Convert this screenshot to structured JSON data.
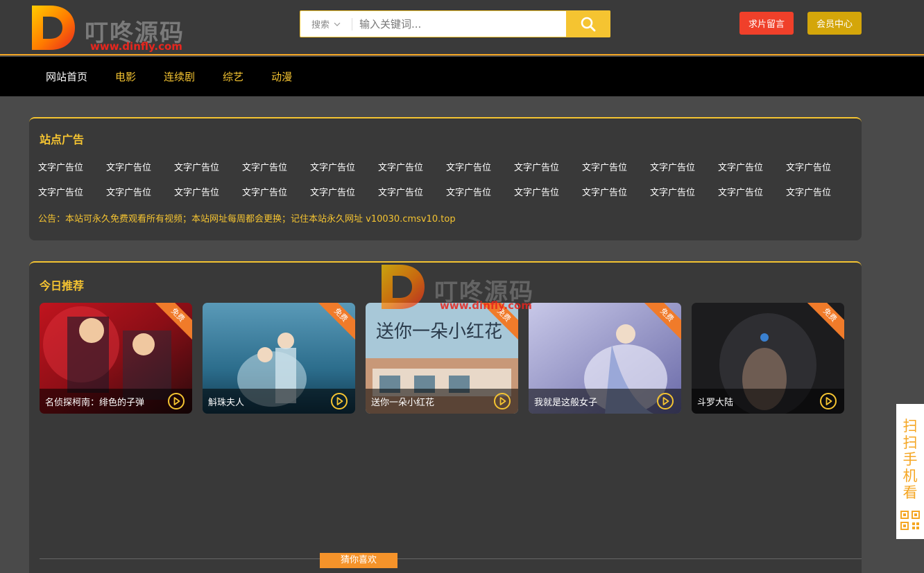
{
  "brand": {
    "name": "叮咚源码",
    "url": "www.dinfly.com"
  },
  "search": {
    "category": "搜索",
    "placeholder": "输入关键词..."
  },
  "header_buttons": {
    "request": "求片留言",
    "member": "会员中心"
  },
  "nav": [
    {
      "label": "网站首页",
      "active": true
    },
    {
      "label": "电影",
      "active": false
    },
    {
      "label": "连续剧",
      "active": false
    },
    {
      "label": "综艺",
      "active": false
    },
    {
      "label": "动漫",
      "active": false
    }
  ],
  "ads": {
    "title": "站点广告",
    "items": [
      "文字广告位",
      "文字广告位",
      "文字广告位",
      "文字广告位",
      "文字广告位",
      "文字广告位",
      "文字广告位",
      "文字广告位",
      "文字广告位",
      "文字广告位",
      "文字广告位",
      "文字广告位",
      "文字广告位",
      "文字广告位",
      "文字广告位",
      "文字广告位",
      "文字广告位",
      "文字广告位",
      "文字广告位",
      "文字广告位",
      "文字广告位",
      "文字广告位",
      "文字广告位",
      "文字广告位"
    ],
    "notice": "公告：本站可永久免费观看所有视频；本站网址每周都会更换；记住本站永久网址 v10030.cmsv10.top"
  },
  "recommend": {
    "title": "今日推荐",
    "badge": "免费",
    "cards": [
      {
        "title": "名侦探柯南：绯色的子弹"
      },
      {
        "title": "斛珠夫人"
      },
      {
        "title": "送你一朵小红花"
      },
      {
        "title": "我就是这般女子"
      },
      {
        "title": "斗罗大陆"
      }
    ]
  },
  "guess": {
    "label": "猜你喜欢"
  },
  "side": {
    "label": "扫扫手机看"
  },
  "colors": {
    "accent": "#f5c431",
    "request": "#f0402a",
    "member": "#d4a60a",
    "badge": "#f07b2a"
  }
}
